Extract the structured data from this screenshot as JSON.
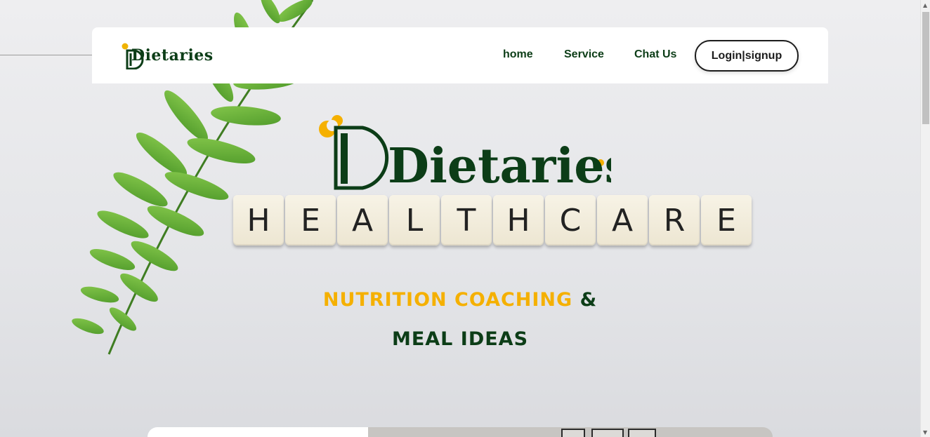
{
  "header": {
    "logo_text": "Dietaries",
    "nav": [
      {
        "label": "home"
      },
      {
        "label": "Service"
      },
      {
        "label": "Chat Us"
      }
    ],
    "login_label": "Login|signup"
  },
  "hero": {
    "logo_text": "Dietaries",
    "tiles": [
      "H",
      "E",
      "A",
      "L",
      "T",
      "H",
      "C",
      "A",
      "R",
      "E"
    ],
    "tagline_part1": "NUTRITION COACHING",
    "tagline_part2": "&",
    "tagline_line2": "MEAL IDEAS"
  },
  "colors": {
    "brand_green": "#0c3d17",
    "accent_yellow": "#f5b000",
    "leaf_green": "#6db33f"
  }
}
